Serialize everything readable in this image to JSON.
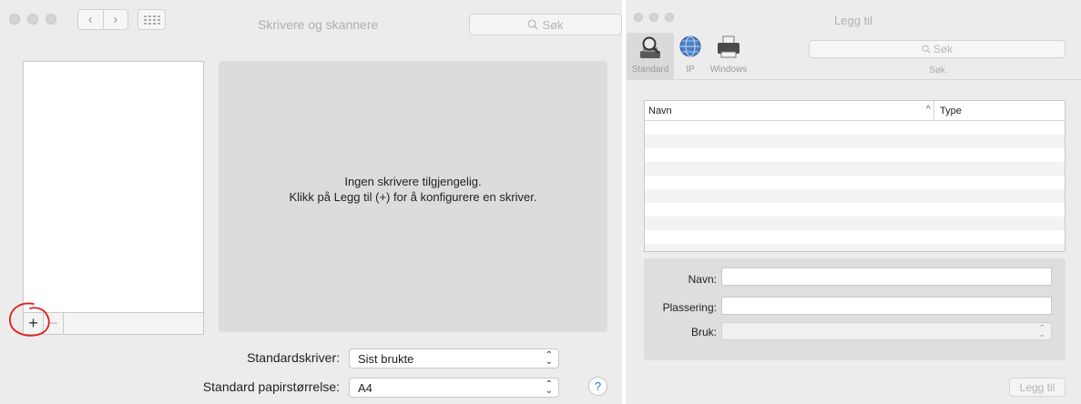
{
  "left_window": {
    "title": "Skrivere og skannere",
    "search_placeholder": "Søk",
    "empty_message_line1": "Ingen skrivere tilgjengelig.",
    "empty_message_line2": "Klikk på Legg til (+) for å konfigurere en skriver.",
    "add_button": "+",
    "remove_button": "−",
    "default_printer_label": "Standardskriver:",
    "default_printer_value": "Sist brukte",
    "paper_size_label": "Standard papirstørrelse:",
    "paper_size_value": "A4",
    "help_button": "?",
    "annotation_color": "#e0201e"
  },
  "right_window": {
    "title": "Legg til",
    "toolbar": [
      {
        "label": "Standard",
        "icon": "default-printer-icon",
        "selected": true
      },
      {
        "label": "IP",
        "icon": "globe-icon",
        "selected": false
      },
      {
        "label": "Windows",
        "icon": "windows-printer-icon",
        "selected": false
      }
    ],
    "search_placeholder": "Søk",
    "search_label": "Søk",
    "table": {
      "col_name": "Navn",
      "col_type": "Type",
      "sort_indicator": "^"
    },
    "fields": {
      "name_label": "Navn:",
      "location_label": "Plassering:",
      "use_label": "Bruk:"
    },
    "add_button": "Legg til"
  }
}
